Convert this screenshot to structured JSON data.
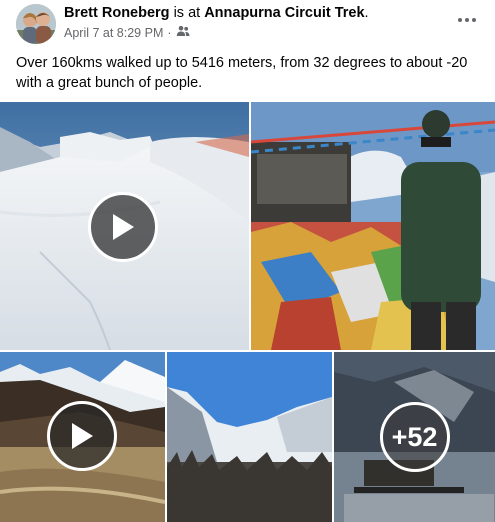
{
  "post": {
    "author": "Brett Roneberg",
    "verb": " is at ",
    "location": "Annapurna Circuit Trek",
    "period": ".",
    "timestamp": "April 7 at 8:29 PM",
    "separator": "·",
    "audience_icon": "friends-icon",
    "more_icon": "more-horizontal-icon",
    "text": "Over 160kms walked up to 5416 meters, from 32 degrees to about -20 with a great bunch of people."
  },
  "media": {
    "items": [
      {
        "kind": "video",
        "scene": "snowy mountain pass"
      },
      {
        "kind": "photo",
        "scene": "trekker at Thorong La prayer flags"
      },
      {
        "kind": "video",
        "scene": "valley with snow peaks"
      },
      {
        "kind": "photo",
        "scene": "snowy valley under blue sky"
      },
      {
        "kind": "photo",
        "scene": "village at dusk"
      }
    ],
    "more_count": "+52"
  },
  "colors": {
    "text_primary": "#050505",
    "text_secondary": "#65676b",
    "play_overlay": "#282828"
  }
}
